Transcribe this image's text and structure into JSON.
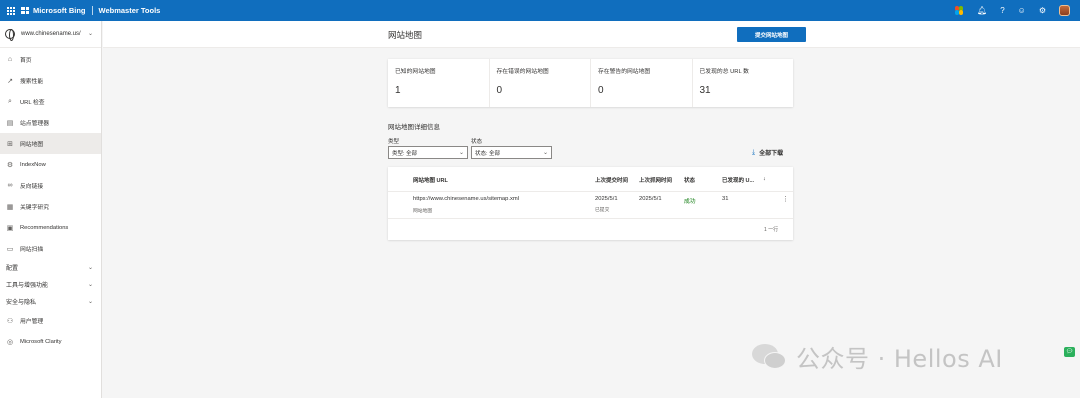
{
  "topbar": {
    "brand": "Microsoft Bing",
    "product": "Webmaster Tools",
    "icons": [
      "waffle-icon",
      "bell-icon",
      "help-icon",
      "feedback-smile-icon",
      "settings-icon",
      "avatar"
    ]
  },
  "sidebar": {
    "site": "www.chinesename.us/",
    "items": [
      {
        "label": "首页",
        "icon": "⌂"
      },
      {
        "label": "搜索性能",
        "icon": "↗"
      },
      {
        "label": "URL 检查",
        "icon": "⌕"
      },
      {
        "label": "站点管理器",
        "icon": "▤"
      },
      {
        "label": "网站地图",
        "icon": "⊞"
      },
      {
        "label": "IndexNow",
        "icon": "⚙"
      },
      {
        "label": "反向链接",
        "icon": "∞"
      },
      {
        "label": "关键字研究",
        "icon": "▦"
      },
      {
        "label": "Recommendations",
        "icon": "▣"
      },
      {
        "label": "网站扫描",
        "icon": "▭"
      }
    ],
    "groups": [
      "配置",
      "工具与增强功能",
      "安全与隐私"
    ],
    "bottom_items": [
      {
        "label": "用户管理",
        "icon": "⚇"
      },
      {
        "label": "Microsoft Clarity",
        "icon": "◎"
      }
    ]
  },
  "header": {
    "title": "网站地图",
    "submit_label": "提交网站地图"
  },
  "stats": [
    {
      "label": "已知的网站地图",
      "value": "1"
    },
    {
      "label": "存在错误的网站地图",
      "value": "0"
    },
    {
      "label": "存在警告的网站地图",
      "value": "0"
    },
    {
      "label": "已发现的总 URL 数",
      "value": "31"
    }
  ],
  "details": {
    "title": "网站地图详细信息",
    "type_label": "类型",
    "type_value": "类型: 全部",
    "status_label": "状态",
    "status_value": "状态: 全部",
    "download_label": "全部下载"
  },
  "table": {
    "columns": [
      "网站地图 URL",
      "上次提交时间",
      "上次抓网时间",
      "状态",
      "已发现的 U...",
      "↓"
    ],
    "rows": [
      {
        "url": "https://www.chinesename.us/sitemap.xml",
        "type": "网站地图",
        "submitted": "2025/5/1",
        "submitted_note": "已提交",
        "crawled": "2025/5/1",
        "status": "成功",
        "urls": "31"
      }
    ],
    "row_count": "1 一行"
  },
  "watermark": {
    "text": "公众号 · Hellos AI"
  }
}
